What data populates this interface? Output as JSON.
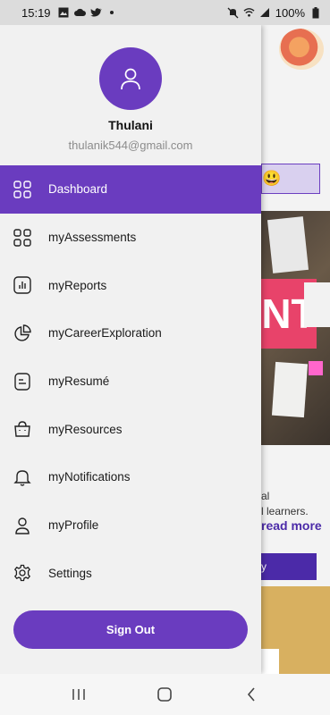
{
  "status_bar": {
    "time": "15:19",
    "battery": "100%",
    "icons": [
      "photo-icon",
      "cloud-icon",
      "twitter-icon",
      "dot-icon",
      "mute-icon",
      "wifi-icon",
      "signal-icon",
      "battery-icon"
    ]
  },
  "drawer": {
    "user": {
      "name": "Thulani",
      "email": "thulanik544@gmail.com"
    },
    "menu": [
      {
        "label": "Dashboard",
        "icon": "grid-icon",
        "active": true
      },
      {
        "label": "myAssessments",
        "icon": "grid-icon",
        "active": false
      },
      {
        "label": "myReports",
        "icon": "bar-chart-icon",
        "active": false
      },
      {
        "label": "myCareerExploration",
        "icon": "pie-chart-icon",
        "active": false
      },
      {
        "label": "myResumé",
        "icon": "document-icon",
        "active": false
      },
      {
        "label": "myResources",
        "icon": "shopping-bag-icon",
        "active": false
      },
      {
        "label": "myNotifications",
        "icon": "bell-icon",
        "active": false
      },
      {
        "label": "myProfile",
        "icon": "user-icon",
        "active": false
      },
      {
        "label": "Settings",
        "icon": "gear-icon",
        "active": false
      }
    ],
    "sign_out_label": "Sign Out"
  },
  "background_page": {
    "line1": "al",
    "line2": "l learners.",
    "read_more": "read more",
    "button_label": "y",
    "photo_text": "NT"
  },
  "colors": {
    "accent": "#6a3cbf",
    "drawer_bg": "#f1f1f1",
    "status_bar_bg": "#dcdcdc"
  }
}
